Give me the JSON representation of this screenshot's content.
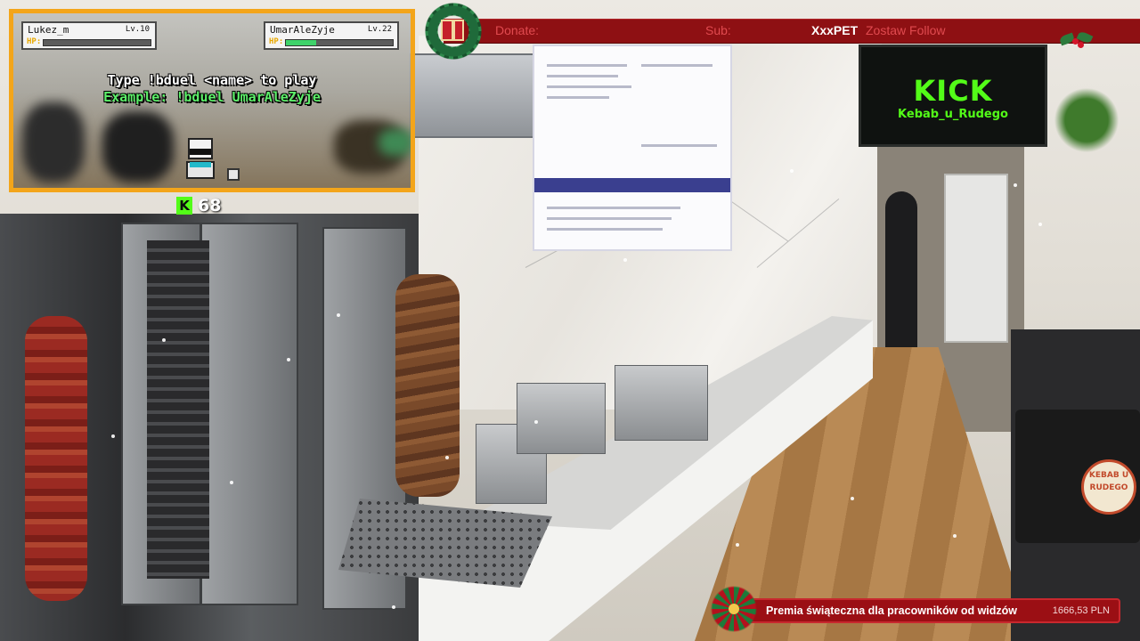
{
  "banner": {
    "donate_label": "Donate:",
    "sub_label": "Sub:",
    "follower_name": "XxxPET",
    "follow_label": "Zostaw Follow"
  },
  "game": {
    "player1": {
      "name": "Lukez_m",
      "level": "Lv.10",
      "hp_label": "HP:",
      "hp_fraction": 0.0
    },
    "player2": {
      "name": "UmarAleZyje",
      "level": "Lv.22",
      "hp_label": "HP:",
      "hp_fraction": 0.28
    },
    "instruction": "Type !bduel <name> to play",
    "example": "Example: !bduel UmarAleZyje",
    "border_color": "#f3a51a"
  },
  "kick": {
    "icon": "kick-logo-icon",
    "icon_glyph": "K",
    "count": "68",
    "color": "#53fc18"
  },
  "tv": {
    "title": "KICK",
    "subtitle": "Kebab_u_Rudego"
  },
  "bag_logo": {
    "text": "KEBAB U RUDEGO"
  },
  "bottom_bar": {
    "title": "Premia świąteczna dla pracowników od widzów",
    "amount": "1666,53 PLN",
    "color": "#9b0f14"
  },
  "colors": {
    "banner_red": "#8e1013",
    "banner_text_red": "#e04a4f",
    "kick_green": "#53fc18"
  }
}
